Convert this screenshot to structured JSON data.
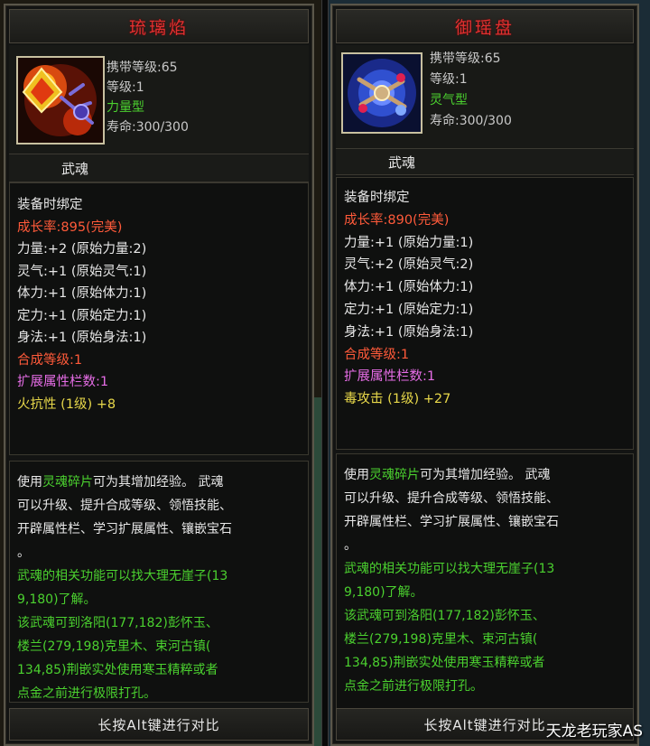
{
  "left_card": {
    "title": "琉璃焰",
    "info": [
      "携带等级:65",
      "等级:1"
    ],
    "type_label": "力量型",
    "lifespan": "寿命:300/300",
    "category": "武魂",
    "bind": "装备时绑定",
    "growth": "成长率:895(完美)",
    "stats": [
      "力量:+2 (原始力量:2)",
      "灵气:+1 (原始灵气:1)",
      "体力:+1 (原始体力:1)",
      "定力:+1 (原始定力:1)",
      "身法:+1 (原始身法:1)"
    ],
    "synth_level": "合成等级:1",
    "ext_slots": "扩展属性栏数:1",
    "resist": "火抗性 (1级) +8",
    "desc_prefix": "使用",
    "desc_item": "灵魂碎片",
    "desc_suffix": "可为其增加经验。 武魂",
    "desc_lines": [
      "可以升级、提升合成等级、领悟技能、",
      "开辟属性栏、学习扩展属性、镶嵌宝石",
      "。"
    ],
    "desc_green": [
      "武魂的相关功能可以找大理无崖子(13",
      "9,180)了解。",
      "该武魂可到洛阳(177,182)彭怀玉、",
      "楼兰(279,198)克里木、束河古镇(",
      "134,85)荆嵌实处使用寒玉精粹或者",
      "点金之前进行极限打孔。"
    ],
    "footer": "长按Alt键进行对比"
  },
  "right_card": {
    "title": "御瑶盘",
    "info": [
      "携带等级:65",
      "等级:1"
    ],
    "type_label": "灵气型",
    "lifespan": "寿命:300/300",
    "category": "武魂",
    "bind": "装备时绑定",
    "growth": "成长率:890(完美)",
    "stats": [
      "力量:+1 (原始力量:1)",
      "灵气:+2 (原始灵气:2)",
      "体力:+1 (原始体力:1)",
      "定力:+1 (原始定力:1)",
      "身法:+1 (原始身法:1)"
    ],
    "synth_level": "合成等级:1",
    "ext_slots": "扩展属性栏数:1",
    "resist": "毒攻击 (1级) +27",
    "desc_prefix": "使用",
    "desc_item": "灵魂碎片",
    "desc_suffix": "可为其增加经验。 武魂",
    "desc_lines": [
      "可以升级、提升合成等级、领悟技能、",
      "开辟属性栏、学习扩展属性、镶嵌宝石",
      "。"
    ],
    "desc_green": [
      "武魂的相关功能可以找大理无崖子(13",
      "9,180)了解。",
      "该武魂可到洛阳(177,182)彭怀玉、",
      "楼兰(279,198)克里木、束河古镇(",
      "134,85)荆嵌实处使用寒玉精粹或者",
      "点金之前进行极限打孔。"
    ],
    "footer": "长按Alt键进行对比"
  },
  "watermark": "天龙老玩家AS",
  "colors": {
    "title_red": "#e03030",
    "green": "#4bd12f",
    "orange_red": "#ff5a3a",
    "pink": "#e66de6",
    "yellow": "#e8d84a"
  },
  "icons": {
    "left_item": "fire-kite-icon",
    "right_item": "blue-orb-disc-icon"
  }
}
